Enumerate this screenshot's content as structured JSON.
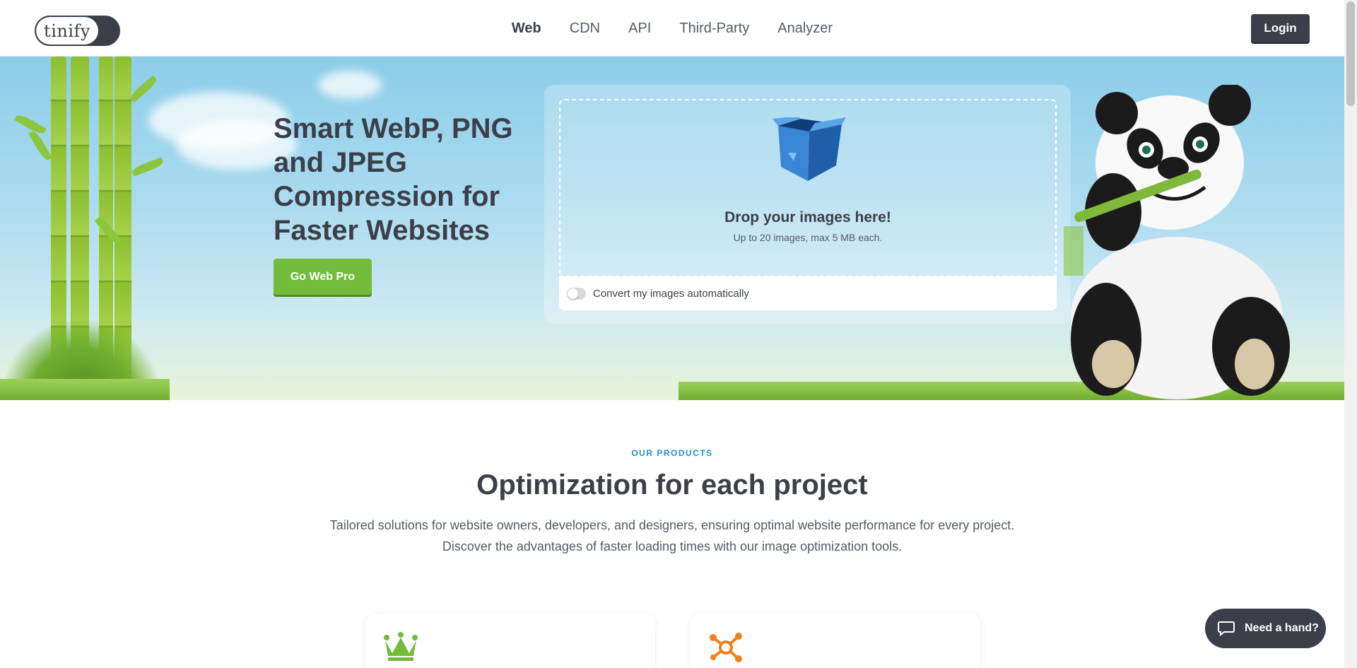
{
  "header": {
    "logo_text": "tinify",
    "nav": [
      {
        "label": "Web",
        "active": true
      },
      {
        "label": "CDN",
        "active": false
      },
      {
        "label": "API",
        "active": false
      },
      {
        "label": "Third-Party",
        "active": false
      },
      {
        "label": "Analyzer",
        "active": false
      }
    ],
    "login_label": "Login"
  },
  "hero": {
    "title": "Smart WebP, PNG and JPEG Compression for Faster Websites",
    "cta_label": "Go Web Pro",
    "dropzone": {
      "title": "Drop your images here!",
      "subtitle": "Up to 20 images, max 5 MB each.",
      "convert_label": "Convert my images automatically",
      "convert_enabled": false
    }
  },
  "products": {
    "eyebrow": "OUR PRODUCTS",
    "title": "Optimization for each project",
    "description": "Tailored solutions for website owners, developers, and designers, ensuring optimal website performance for every project. Discover the advantages of faster loading times with our image optimization tools.",
    "cards": [
      {
        "icon": "crown-icon"
      },
      {
        "icon": "network-icon"
      }
    ]
  },
  "chat": {
    "label": "Need a hand?"
  },
  "colors": {
    "dark": "#3b3f4a",
    "accent_green": "#72bb3b",
    "accent_blue": "#1f8fd6",
    "accent_orange": "#f07f1e"
  }
}
